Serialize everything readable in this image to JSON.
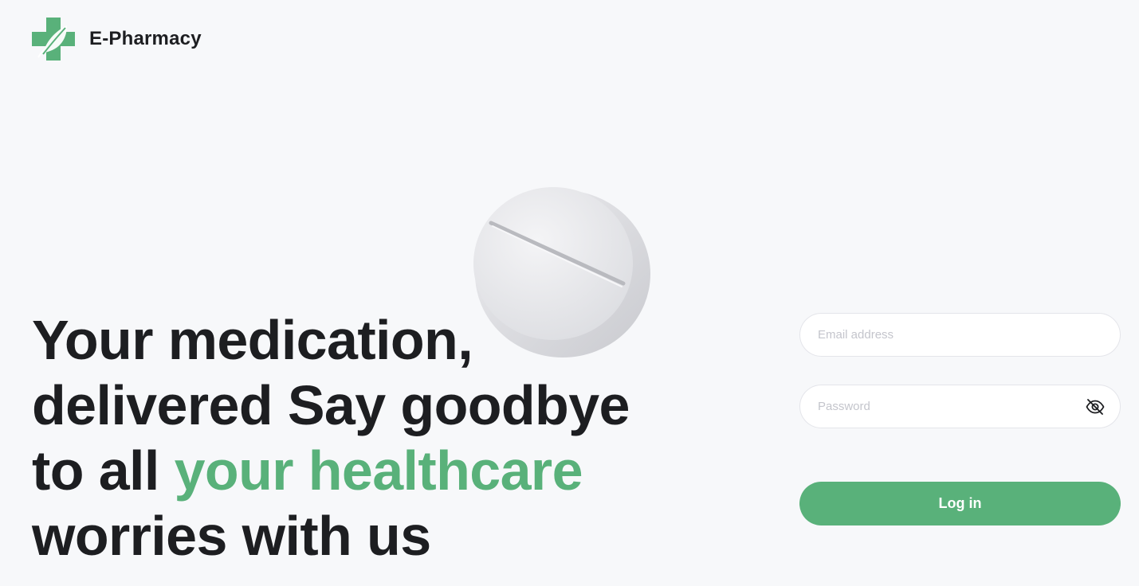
{
  "brand": {
    "name": "E-Pharmacy",
    "logo_icon": "green-cross-leaf-icon",
    "accent_color": "#59b17a"
  },
  "hero": {
    "line1": "Your medication,",
    "line2": "delivered Say goodbye",
    "line3_prefix": "to all ",
    "line3_highlight": "your healthcare",
    "line4": "worries with us",
    "decoration_icon": "pill-icon"
  },
  "login_form": {
    "email_placeholder": "Email address",
    "password_placeholder": "Password",
    "toggle_icon": "eye-off-icon",
    "submit_label": "Log in"
  }
}
